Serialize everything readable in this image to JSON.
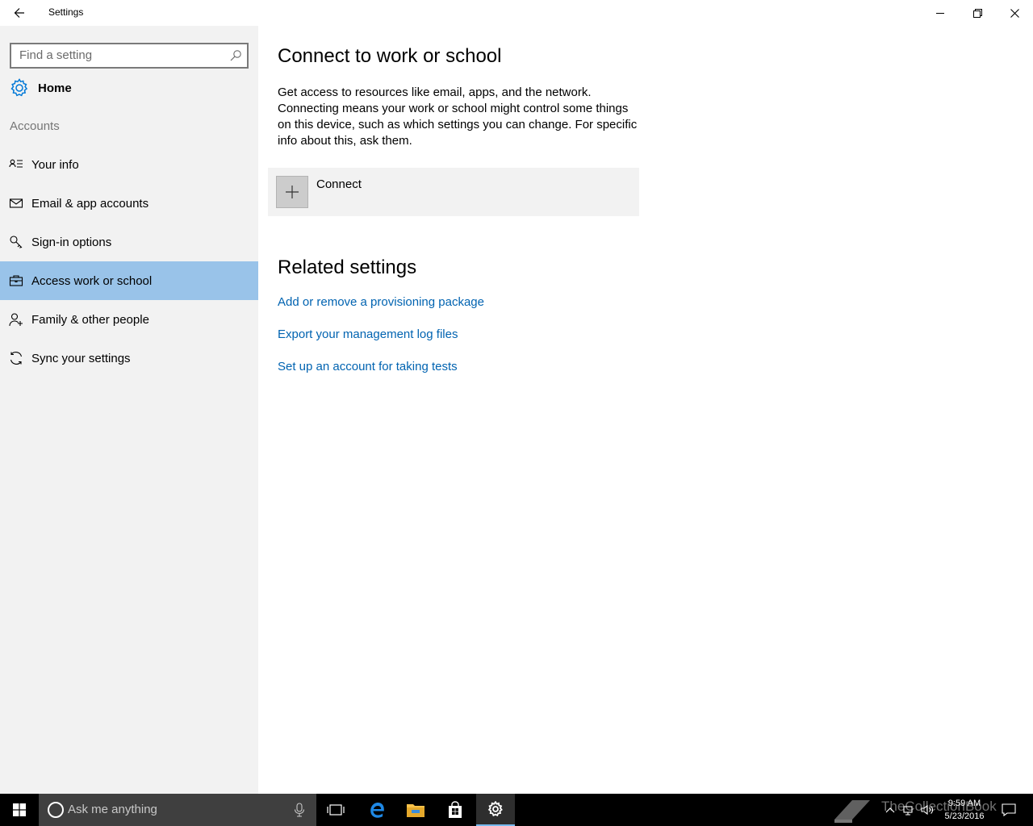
{
  "window": {
    "title": "Settings"
  },
  "sidebar": {
    "search_placeholder": "Find a setting",
    "home_label": "Home",
    "section_label": "Accounts",
    "items": [
      {
        "label": "Your info",
        "icon": "person-card-icon",
        "selected": false
      },
      {
        "label": "Email & app accounts",
        "icon": "mail-icon",
        "selected": false
      },
      {
        "label": "Sign-in options",
        "icon": "key-icon",
        "selected": false
      },
      {
        "label": "Access work or school",
        "icon": "briefcase-icon",
        "selected": true
      },
      {
        "label": "Family & other people",
        "icon": "people-icon",
        "selected": false
      },
      {
        "label": "Sync your settings",
        "icon": "sync-icon",
        "selected": false
      }
    ]
  },
  "main": {
    "title": "Connect to work or school",
    "description": "Get access to resources like email, apps, and the network. Connecting means your work or school might control some things on this device, such as which settings you can change. For specific info about this, ask them.",
    "connect_label": "Connect",
    "related_title": "Related settings",
    "links": [
      "Add or remove a provisioning package",
      "Export your management log files",
      "Set up an account for taking tests"
    ]
  },
  "taskbar": {
    "search_placeholder": "Ask me anything",
    "time": "9:59 AM",
    "date": "5/23/2016",
    "watermark": "TheCollectionBook"
  },
  "colors": {
    "selected_bg": "#99c3e9",
    "link": "#0063b1",
    "accent": "#0078d7",
    "sidebar_bg": "#f2f2f2"
  }
}
